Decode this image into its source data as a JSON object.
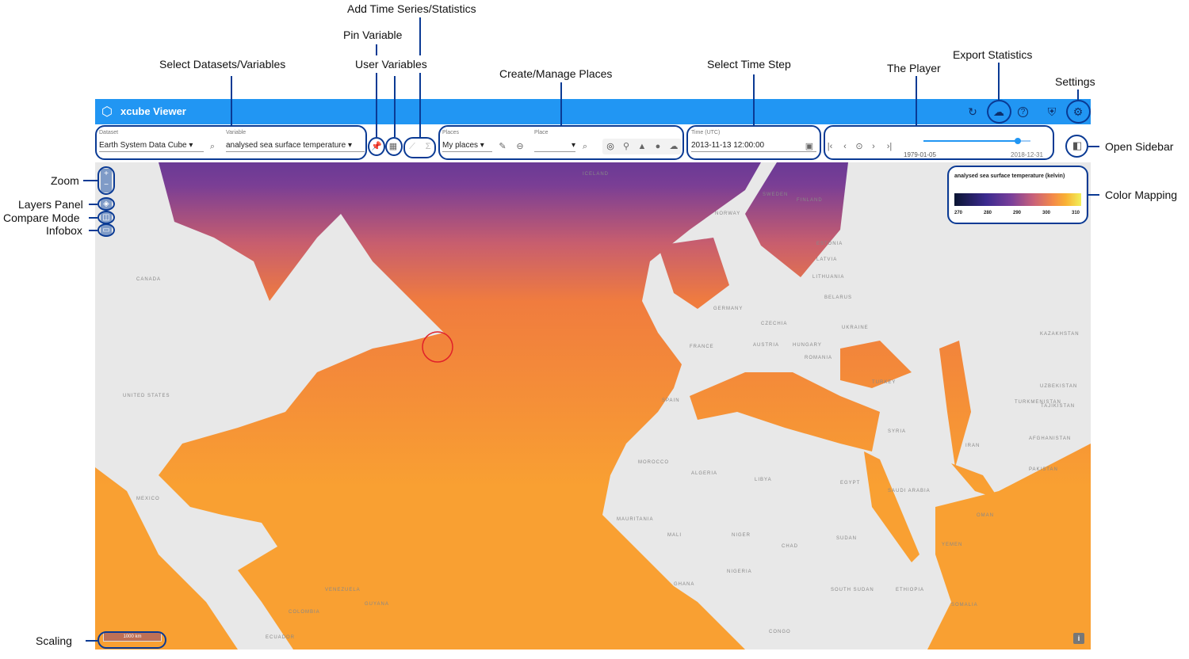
{
  "app": {
    "title": "xcube Viewer"
  },
  "header_icons": [
    "refresh-icon",
    "cloud-download-icon",
    "help-icon",
    "shield-icon",
    "gear-icon"
  ],
  "toolbar": {
    "dataset_label": "Dataset",
    "dataset_value": "Earth System Data Cube",
    "variable_label": "Variable",
    "variable_value": "analysed sea surface temperature",
    "places_label": "Places",
    "places_value": "My places",
    "place_label": "Place",
    "place_value": "",
    "time_label": "Time (UTC)",
    "time_value": "2013-11-13 12:00:00",
    "player_start": "1979-01-05",
    "player_end": "2018-12-31",
    "player_progress": 0.88
  },
  "legend": {
    "title": "analysed sea surface temperature (kelvin)",
    "ticks": [
      "270",
      "280",
      "290",
      "300",
      "310"
    ],
    "colormap": [
      "#0b1533",
      "#3b2a8f",
      "#c8607a",
      "#f48a48",
      "#f1f05a"
    ]
  },
  "scale": {
    "label": "1000 km"
  },
  "map_labels": [
    "CANADA",
    "UNITED STATES",
    "MEXICO",
    "ICELAND",
    "SWEDEN",
    "FINLAND",
    "NORWAY",
    "ESTONIA",
    "LATVIA",
    "LITHUANIA",
    "BELARUS",
    "UKRAINE",
    "KAZAKHSTAN",
    "GERMANY",
    "CZECHIA",
    "FRANCE",
    "AUSTRIA",
    "HUNGARY",
    "ROMANIA",
    "SPAIN",
    "TURKEY",
    "SYRIA",
    "IRAN",
    "UZBEKISTAN",
    "TURKMENISTAN",
    "TAJIKISTAN",
    "AFGHANISTAN",
    "PAKISTAN",
    "MOROCCO",
    "ALGERIA",
    "LIBYA",
    "EGYPT",
    "SAUDI ARABIA",
    "OMAN",
    "YEMEN",
    "MAURITANIA",
    "MALI",
    "NIGER",
    "CHAD",
    "SUDAN",
    "ETHIOPIA",
    "SOMALIA",
    "NIGERIA",
    "GHANA",
    "SOUTH SUDAN",
    "CONGO",
    "VENEZUELA",
    "GUYANA",
    "COLOMBIA",
    "ECUADOR"
  ],
  "annotations": {
    "add_ts": "Add Time Series/Statistics",
    "pin": "Pin Variable",
    "select_ds": "Select Datasets/Variables",
    "user_vars": "User Variables",
    "places": "Create/Manage Places",
    "time": "Select Time Step",
    "player": "The Player",
    "export": "Export Statistics",
    "settings": "Settings",
    "sidebar": "Open Sidebar",
    "colormap": "Color Mapping",
    "zoom": "Zoom",
    "layers": "Layers Panel",
    "compare": "Compare Mode",
    "infobox": "Infobox",
    "scaling": "Scaling"
  }
}
